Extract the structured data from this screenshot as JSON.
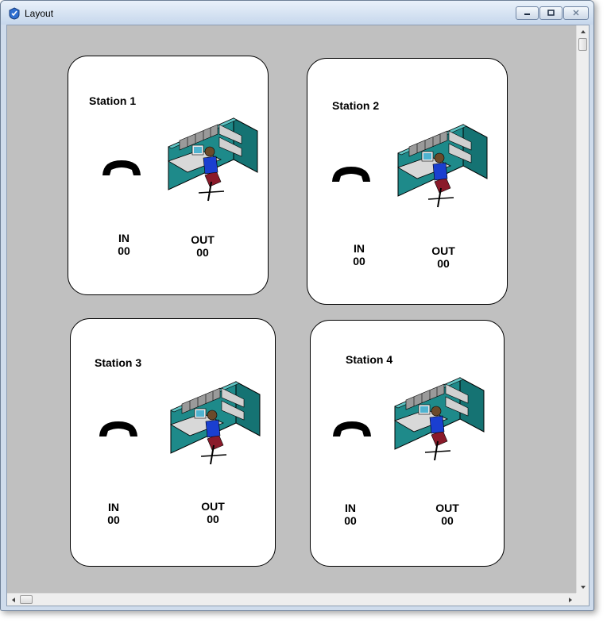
{
  "window": {
    "title": "Layout"
  },
  "colors": {
    "canvas": "#c0c0c0",
    "card": "#ffffff",
    "cubicle": "#1f8c8c",
    "person_shirt": "#1a3fd0"
  },
  "stations": [
    {
      "title": "Station 1",
      "in_label": "IN",
      "in_value": "00",
      "out_label": "OUT",
      "out_value": "00"
    },
    {
      "title": "Station 2",
      "in_label": "IN",
      "in_value": "00",
      "out_label": "OUT",
      "out_value": "00"
    },
    {
      "title": "Station 3",
      "in_label": "IN",
      "in_value": "00",
      "out_label": "OUT",
      "out_value": "00"
    },
    {
      "title": "Station 4",
      "in_label": "IN",
      "in_value": "00",
      "out_label": "OUT",
      "out_value": "00"
    }
  ],
  "icons": {
    "phone": "phone-handset-icon",
    "workstation": "cubicle-workstation-icon"
  }
}
